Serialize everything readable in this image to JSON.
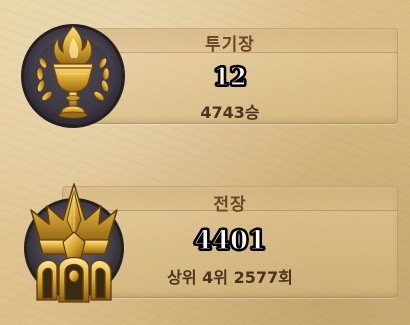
{
  "arena": {
    "title": "투기장",
    "value": "12",
    "sub": "4743승",
    "icon": "golden-torch-laurel-icon"
  },
  "battlegrounds": {
    "title": "전장",
    "value": "4401",
    "sub": "상위 4위 2577회",
    "icon": "golden-crown-icon"
  },
  "colors": {
    "parchment": "#dcc08b",
    "title_brown": "#6b4526",
    "gold": "#e0b13a",
    "emblem_ring": "#4a4550"
  }
}
